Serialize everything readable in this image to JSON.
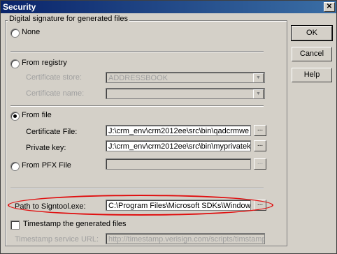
{
  "window": {
    "title": "Security",
    "close_glyph": "✕"
  },
  "buttons": {
    "ok": "OK",
    "cancel": "Cancel",
    "help": "Help"
  },
  "group": {
    "legend": "Digital signature for generated files"
  },
  "options": {
    "none": "None",
    "from_registry": "From registry",
    "from_file": "From file",
    "from_pfx": "From PFX File"
  },
  "registry": {
    "store_label": "Certificate store:",
    "store_value": "ADDRESSBOOK",
    "name_label": "Certificate name:",
    "name_value": ""
  },
  "file": {
    "cert_label": "Certificate File:",
    "cert_value": "J:\\crm_env\\crm2012ee\\src\\bin\\qadcrmwe",
    "key_label": "Private key:",
    "key_value": "J:\\crm_env\\crm2012ee\\src\\bin\\myprivatek"
  },
  "pfx": {
    "value": ""
  },
  "signtool": {
    "label": "Path to Signtool.exe:",
    "value": "C:\\Program Files\\Microsoft SDKs\\Windows"
  },
  "timestamp": {
    "checkbox_label": "Timestamp the generated files",
    "url_label": "Timestamp service URL:",
    "url_value": "http://timestamp.verisign.com/scripts/timstamp.c"
  },
  "browse_glyph": "...",
  "dropdown_glyph": "▼",
  "colors": {
    "title_bar": "#0a246a",
    "annotation_ellipse": "#e01010",
    "dialog_face": "#d4d0c8"
  }
}
